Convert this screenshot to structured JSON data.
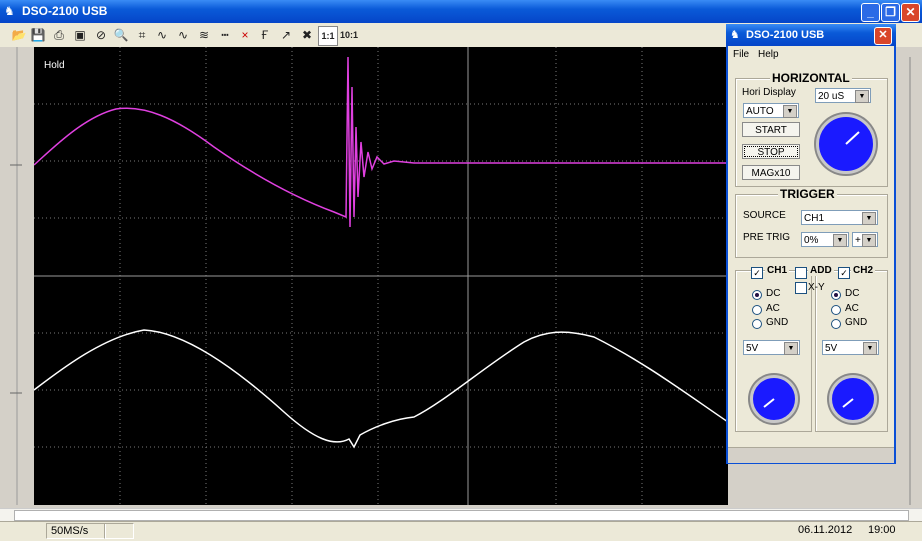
{
  "window": {
    "title": "DSO-2100 USB"
  },
  "toolbar": {
    "icons": [
      "open-icon",
      "save-icon",
      "print-icon",
      "stop-icon",
      "zoom-icon",
      "cursor-icon",
      "wave-icon",
      "wave2-icon",
      "math-icon",
      "ref-icon",
      "clear-icon",
      "fft-icon",
      "auto-icon",
      "delete-icon"
    ],
    "btn_11": "1:1",
    "btn_101": "10:1"
  },
  "scope": {
    "hold": "Hold"
  },
  "statusbar": {
    "rate": "50MS/s",
    "date": "06.11.2012",
    "time": "19:00"
  },
  "panel": {
    "title": "DSO-2100 USB",
    "menu": [
      "File",
      "Help"
    ],
    "horizontal": {
      "title": "HORIZONTAL",
      "hori_display_label": "Hori Display",
      "mode": "AUTO",
      "timebase": "20 uS",
      "start": "START",
      "stop": "STOP",
      "mag": "MAGx10"
    },
    "trigger": {
      "title": "TRIGGER",
      "source_label": "SOURCE",
      "source": "CH1",
      "pretrig_label": "PRE TRIG",
      "pretrig": "0%",
      "slope": "+"
    },
    "channels": {
      "ch1_label": "CH1",
      "add_label": "ADD",
      "xy_label": "X-Y",
      "ch2_label": "CH2",
      "coupling": [
        "DC",
        "AC",
        "GND"
      ],
      "ch1_volts": "5V",
      "ch2_volts": "5V"
    }
  },
  "colors": {
    "ch1": "#e040e0",
    "ch2": "#ffffff",
    "accent": "#0a5ad8"
  }
}
